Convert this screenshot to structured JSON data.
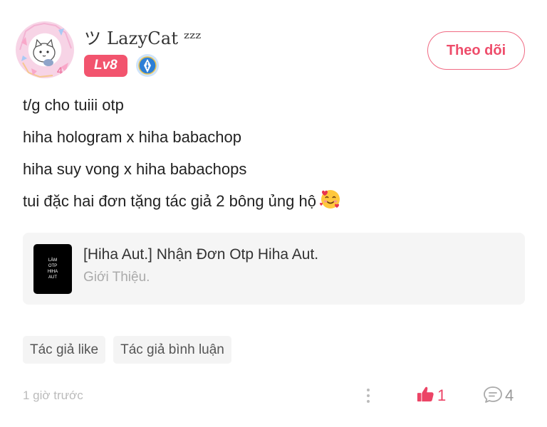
{
  "author": {
    "display_name": "ツ LazyCat ᶻᶻᶻ",
    "level": "Lv8",
    "avatar_icon": "cat-avatar-icon",
    "medal_icon": "pen-medal-icon"
  },
  "follow_button": {
    "label": "Theo dõi"
  },
  "post": {
    "lines": [
      "t/g cho tuiii otp",
      "hiha hologram x hiha babachop",
      "hiha suy vong x hiha babachops",
      "tui đặc hai đơn tặng tác giả 2 bông ủng hộ"
    ],
    "emoji_icon": "smiling-face-with-hearts-icon"
  },
  "linked_story": {
    "thumbnail_lines": [
      "LÀM",
      "OTP",
      "HIHA",
      "AUT"
    ],
    "title": "[Hiha Aut.] Nhận Đơn Otp Hiha Aut.",
    "subtitle": "Giới Thiệu."
  },
  "tags": [
    "Tác giả like",
    "Tác giả bình luận"
  ],
  "footer": {
    "time": "1 giờ trước",
    "like_count": "1",
    "comment_count": "4"
  },
  "colors": {
    "accent": "#ee4d6b",
    "level_badge": "#f2546e",
    "medal": "#2d7fd6"
  }
}
